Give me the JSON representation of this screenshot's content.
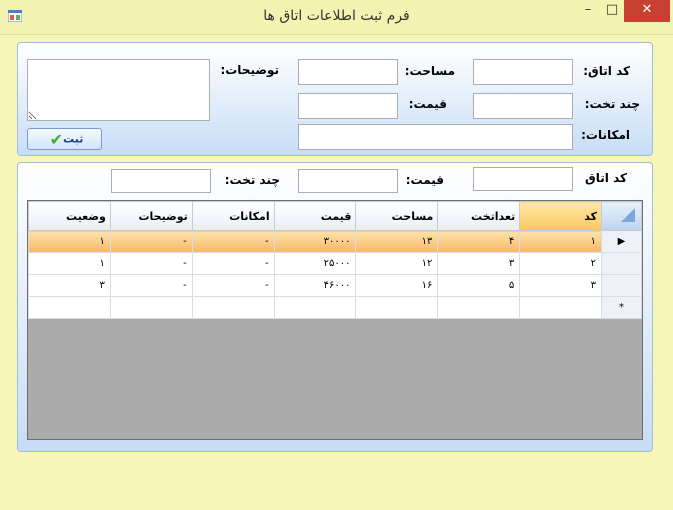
{
  "window": {
    "title": "فرم ثبت اطلاعات اتاق ها"
  },
  "form": {
    "room_code_label": "کد اتاق:",
    "area_label": "مساحت:",
    "description_label": "توضیحات:",
    "beds_label": "چند تخت:",
    "price_label": "قیمت:",
    "facilities_label": "امکانات:",
    "save_label": "ثبت"
  },
  "search": {
    "room_code_label": "کد اتاق",
    "price_label": "قیمت:",
    "beds_label": "چند تخت:"
  },
  "grid": {
    "columns": [
      "کد",
      "تعداتخت",
      "مساحت",
      "قیمت",
      "امکانات",
      "توضیحات",
      "وضعیت"
    ],
    "rows": [
      [
        "۱",
        "۴",
        "۱۳",
        "۳۰۰۰۰",
        "-",
        "-",
        "۱"
      ],
      [
        "۲",
        "۳",
        "۱۲",
        "۲۵۰۰۰",
        "-",
        "-",
        "۱"
      ],
      [
        "۳",
        "۵",
        "۱۶",
        "۴۶۰۰۰",
        "-",
        "-",
        "۳"
      ]
    ],
    "current_row_marker": "▶",
    "new_row_marker": "*"
  },
  "colors": {
    "selected_row": "#f8b769",
    "close_button": "#c84031",
    "form_background": "#f6f6b8"
  }
}
